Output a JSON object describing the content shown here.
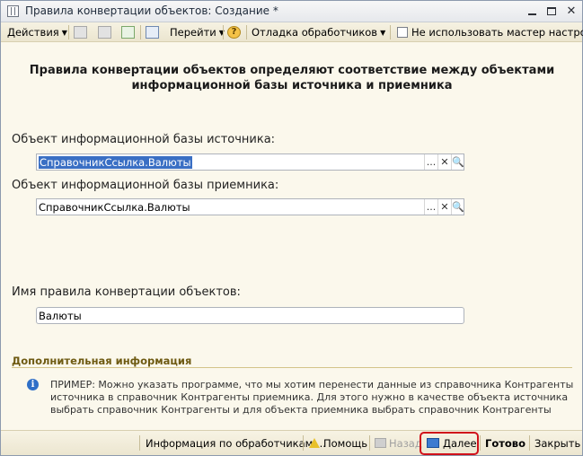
{
  "window": {
    "title": "Правила конвертации объектов: Создание *"
  },
  "toolbar": {
    "actions_label": "Действия",
    "goto_label": "Перейти",
    "debug_label": "Отладка обработчиков",
    "no_wizard_label": "Не использовать мастер настроек",
    "help_glyph": "?"
  },
  "heading": {
    "line1": "Правила конвертации объектов определяют соответствие между объектами",
    "line2": "информационной базы источника и приемника"
  },
  "source": {
    "label": "Объект информационной базы источника:",
    "value": "СправочникСсылка.Валюты"
  },
  "target": {
    "label": "Объект информационной базы приемника:",
    "value": "СправочникСсылка.Валюты"
  },
  "rule_name": {
    "label": "Имя правила конвертации объектов:",
    "value": "Валюты"
  },
  "field_buttons": {
    "select": "...",
    "clear": "✕",
    "open": "🔍"
  },
  "extra": {
    "title": "Дополнительная информация",
    "info_glyph": "i",
    "text": "ПРИМЕР: Можно указать программе, что мы хотим перенести данные из справочника Контрагенты источника в справочник Контрагенты приемника. Для этого нужно в качестве объекта источника выбрать справочник Контрагенты и для объекта приемника выбрать справочник Контрагенты"
  },
  "bottom": {
    "handlers_info": "Информация по обработчикам ...",
    "help": "Помощь",
    "back": "Назад",
    "next": "Далее",
    "done": "Готово",
    "close": "Закрыть"
  },
  "colors": {
    "highlight": "#d0101a",
    "selection": "#3a6fc4",
    "section_title": "#6e5a12"
  }
}
